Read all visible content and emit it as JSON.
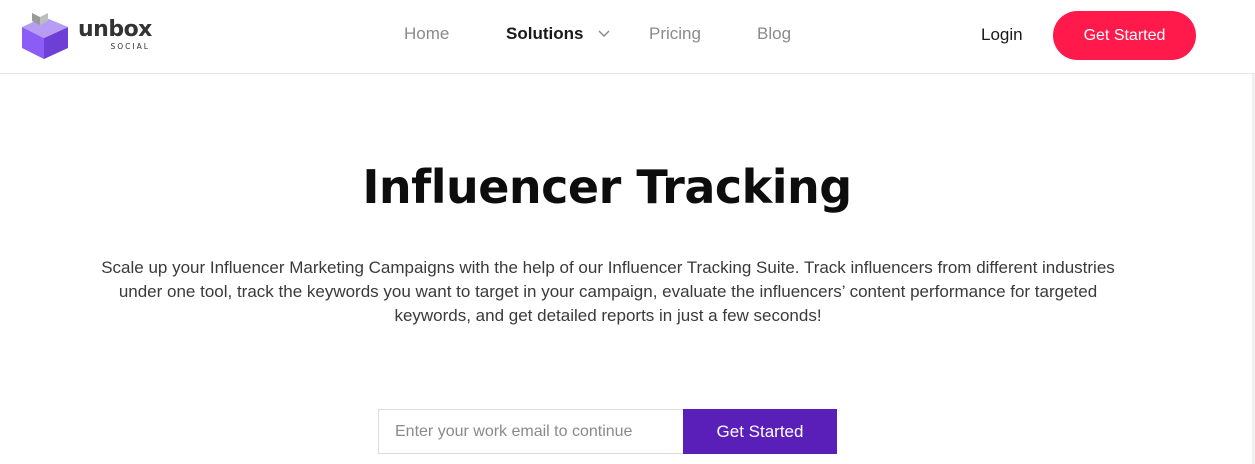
{
  "brand": {
    "name": "unbox",
    "tagline": "SOCIAL",
    "colors": {
      "primary_purple": "#5a1fb8",
      "logo_purple": "#8b5cf6",
      "cta_red": "#ff1a4b"
    }
  },
  "nav": {
    "items": [
      {
        "label": "Home"
      },
      {
        "label": "Solutions",
        "active": true
      },
      {
        "label": "Pricing"
      },
      {
        "label": "Blog"
      }
    ],
    "solutions_icon": "chevron-down-icon"
  },
  "header": {
    "login_label": "Login",
    "cta_label": "Get Started"
  },
  "hero": {
    "title": "Influencer Tracking",
    "description_lines": [
      "Scale up your Influencer Marketing Campaigns with the help of our Influencer Tracking Suite. Track influencers from different industries",
      "under one tool, track the keywords you want to target in your campaign, evaluate the influencers’ content performance for targeted",
      "keywords, and get detailed reports in just a few seconds!"
    ]
  },
  "signup_form": {
    "email_placeholder": "Enter your work email to continue",
    "email_value": "",
    "submit_label": "Get Started"
  }
}
